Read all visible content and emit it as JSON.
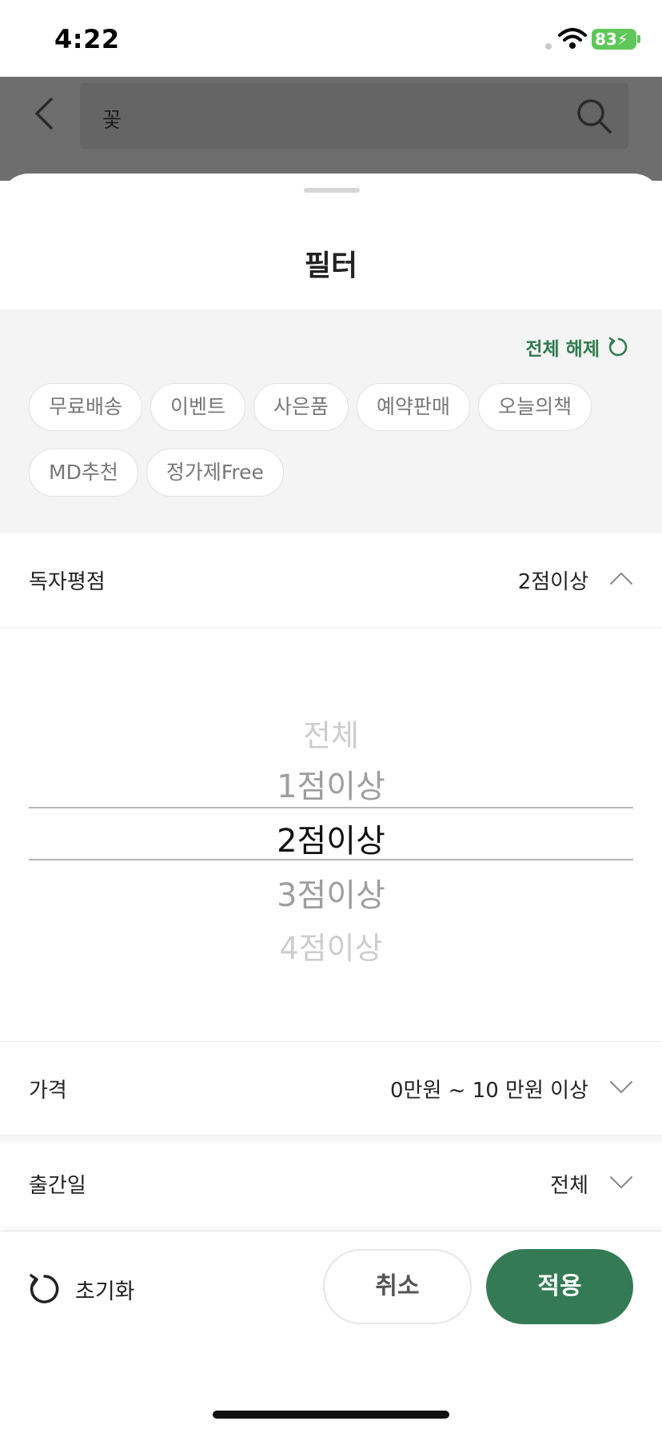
{
  "status_bar": {
    "time": "4:22",
    "battery": "83"
  },
  "search_header": {
    "query": "꽃"
  },
  "sheet": {
    "title": "필터",
    "reset_all_label": "전체 해제",
    "chips": [
      "무료배송",
      "이벤트",
      "사은품",
      "예약판매",
      "오늘의책",
      "MD추천",
      "정가제Free"
    ],
    "rating": {
      "label": "독자평점",
      "value": "2점이상",
      "options": [
        "전체",
        "1점이상",
        "2점이상",
        "3점이상",
        "4점이상"
      ],
      "selected_index": 2
    },
    "price": {
      "label": "가격",
      "value": "0만원 ~ 10 만원 이상"
    },
    "release": {
      "label": "출간일",
      "value": "전체"
    }
  },
  "bottom_bar": {
    "reset_label": "초기화",
    "cancel_label": "취소",
    "apply_label": "적용"
  },
  "colors": {
    "accent": "#347b55",
    "accent_text": "#2e7a4f",
    "battery": "#5fc75a"
  }
}
